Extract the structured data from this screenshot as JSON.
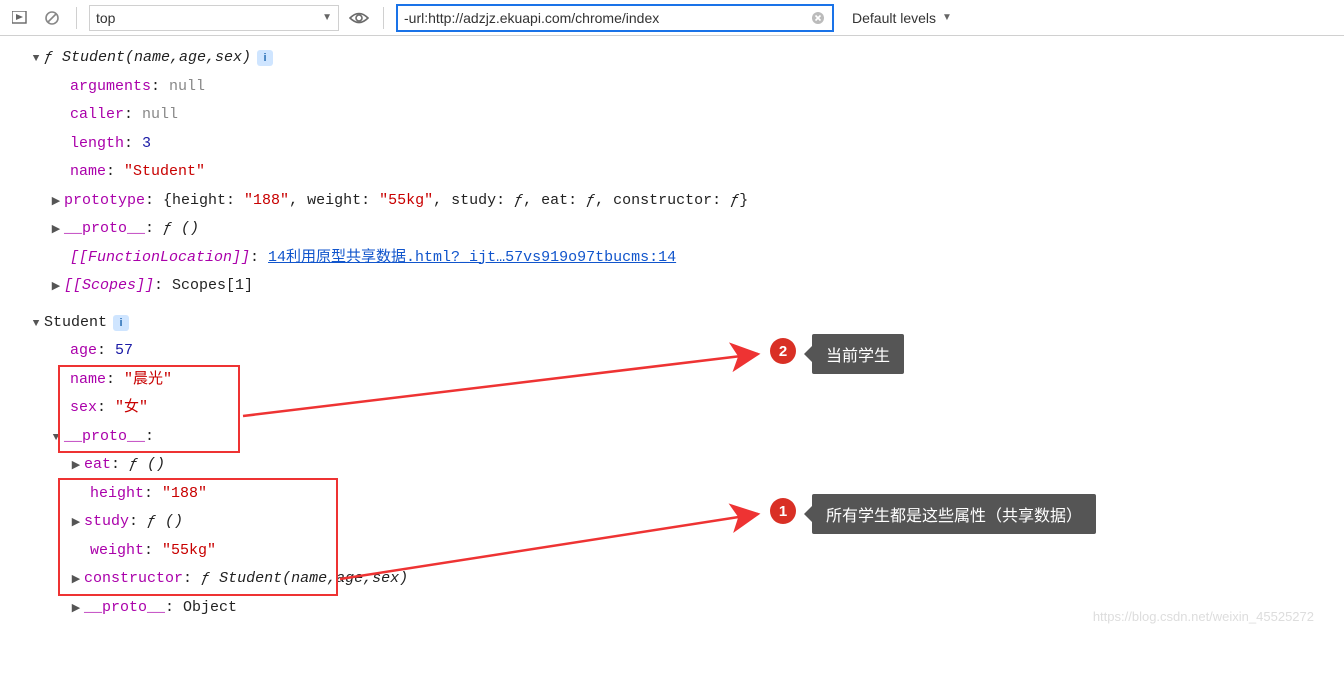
{
  "toolbar": {
    "context": "top",
    "filter": "-url:http://adzjz.ekuapi.com/chrome/index",
    "levels": "Default levels"
  },
  "fn": {
    "header_f": "ƒ ",
    "header_sig": "Student(name,age,sex)",
    "arguments_k": "arguments",
    "arguments_v": "null",
    "caller_k": "caller",
    "caller_v": "null",
    "length_k": "length",
    "length_v": "3",
    "name_k": "name",
    "name_v": "\"Student\"",
    "proto_k": "prototype",
    "proto_open": "{height: ",
    "proto_h": "\"188\"",
    "proto_mid1": ", weight: ",
    "proto_w": "\"55kg\"",
    "proto_mid2": ", study: ",
    "proto_f1": "ƒ",
    "proto_mid3": ", eat: ",
    "proto_f2": "ƒ",
    "proto_mid4": ", constructor: ",
    "proto_f3": "ƒ",
    "proto_close": "}",
    "dproto_k": "__proto__",
    "dproto_v": "ƒ ()",
    "funcloc_k": "[[FunctionLocation]]",
    "funcloc_v": "14利用原型共享数据.html?_ijt…57vs919o97tbucms:14",
    "scopes_k": "[[Scopes]]",
    "scopes_v": "Scopes[1]"
  },
  "obj": {
    "header": "Student",
    "age_k": "age",
    "age_v": "57",
    "name_k": "name",
    "name_v": "\"晨光\"",
    "sex_k": "sex",
    "sex_v": "\"女\"",
    "proto_k": "__proto__",
    "eat_k": "eat",
    "eat_v": "ƒ ()",
    "height_k": "height",
    "height_v": "\"188\"",
    "study_k": "study",
    "study_v": "ƒ ()",
    "weight_k": "weight",
    "weight_v": "\"55kg\"",
    "ctor_k": "constructor",
    "ctor_f": "ƒ ",
    "ctor_sig": "Student(name,age,sex)",
    "dproto_k": "__proto__",
    "dproto_v": "Object"
  },
  "anno": {
    "badge1": "1",
    "tooltip1": "所有学生都是这些属性（共享数据）",
    "badge2": "2",
    "tooltip2": "当前学生"
  },
  "watermark": "https://blog.csdn.net/weixin_45525272"
}
